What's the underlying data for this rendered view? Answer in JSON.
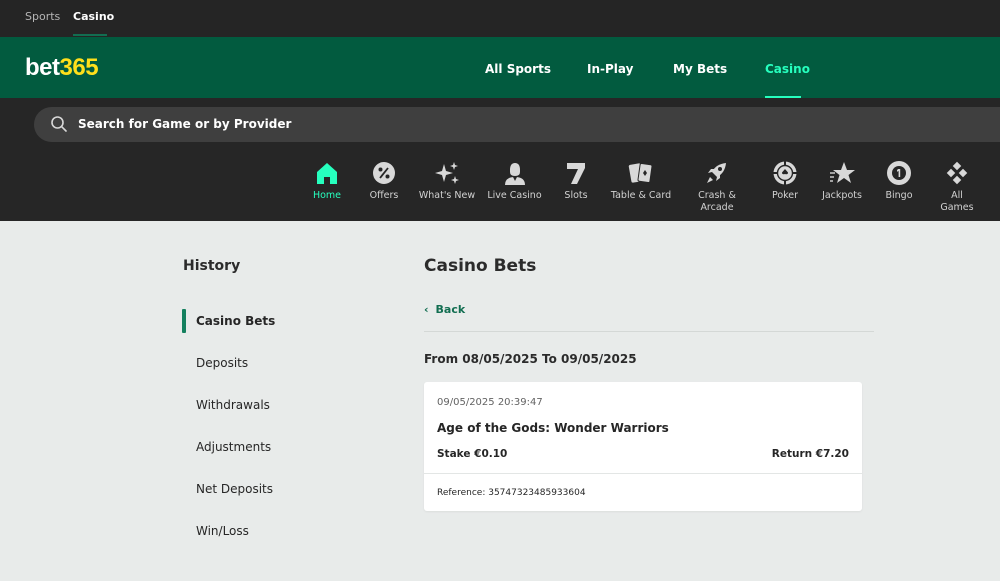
{
  "top_links": [
    {
      "label": "Sports"
    },
    {
      "label": "Casino"
    }
  ],
  "header": {
    "logo_part1": "bet",
    "logo_part2": "365",
    "nav": [
      {
        "label": "All Sports"
      },
      {
        "label": "In-Play"
      },
      {
        "label": "My Bets"
      },
      {
        "label": "Casino"
      }
    ]
  },
  "search": {
    "placeholder": "Search for Game or by Provider"
  },
  "categories": [
    {
      "line1": "Home",
      "icon": "home-icon"
    },
    {
      "line1": "Offers",
      "icon": "percent-icon"
    },
    {
      "line1": "What's New",
      "icon": "sparkle-icon"
    },
    {
      "line1": "Live Casino",
      "icon": "dealer-icon"
    },
    {
      "line1": "Slots",
      "icon": "seven-icon"
    },
    {
      "line1": "Table & Card",
      "icon": "cards-icon"
    },
    {
      "line1": "Crash &",
      "line2": "Arcade",
      "icon": "rocket-icon"
    },
    {
      "line1": "Poker",
      "icon": "poker-chip-icon"
    },
    {
      "line1": "Jackpots",
      "icon": "star-icon"
    },
    {
      "line1": "Bingo",
      "icon": "bingo-ball-icon"
    },
    {
      "line1": "All Games",
      "icon": "grid-icon"
    }
  ],
  "sidebar": {
    "title": "History",
    "items": [
      {
        "label": "Casino Bets"
      },
      {
        "label": "Deposits"
      },
      {
        "label": "Withdrawals"
      },
      {
        "label": "Adjustments"
      },
      {
        "label": "Net Deposits"
      },
      {
        "label": "Win/Loss"
      }
    ]
  },
  "main": {
    "title": "Casino Bets",
    "back_label": "Back",
    "date_range": "From 08/05/2025 To 09/05/2025",
    "bet": {
      "timestamp": "09/05/2025 20:39:47",
      "game": "Age of the Gods: Wonder Warriors",
      "stake": "Stake €0.10",
      "return": "Return €7.20",
      "reference": "Reference: 35747323485933604"
    }
  },
  "colors": {
    "brand_green": "#025b3f",
    "accent_green": "#26ffbe",
    "logo_yellow": "#ffdf1b",
    "dark_bg": "#262626",
    "page_bg": "#e8ebea"
  }
}
